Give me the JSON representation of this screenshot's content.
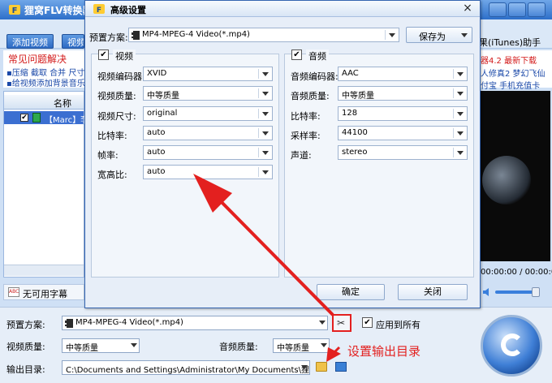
{
  "main": {
    "title": "狸窝FLV转换器",
    "toolbar": {
      "add_video": "添加视频",
      "video2": "视频",
      "itunes": "果(iTunes)助手"
    },
    "faq": {
      "title": "常见问题解决",
      "line1": "▪压缩 截取 合并 尺寸",
      "line2": "▪给视频添加背景音乐"
    },
    "ads": {
      "line1": "器4.2 最新下载",
      "line2": "人修真2 梦幻飞仙",
      "line3": "付宝 手机充值卡"
    },
    "list": {
      "header": "名称",
      "row_text": "【Marc】李"
    },
    "time": "00:00:00 / 00:00:00",
    "subtitle": {
      "label": "无可用字幕",
      "icon_text": "ABC"
    },
    "bottom": {
      "preset_label": "预置方案:",
      "preset_value": "MP4-MPEG-4 Video(*.mp4)",
      "apply_all_label": "应用到所有",
      "video_quality_label": "视频质量:",
      "video_quality_value": "中等质量",
      "audio_quality_label": "音频质量:",
      "audio_quality_value": "中等质量",
      "output_label": "输出目录:",
      "output_value": "C:\\Documents and Settings\\Administrator\\My Documents\\狸窝\\F..."
    },
    "annotation": "设置输出目录"
  },
  "dialog": {
    "title": "高级设置",
    "close_glyph": "×",
    "preset_label": "预置方案:",
    "preset_value": "MP4-MPEG-4 Video(*.mp4)",
    "save_as": "保存为",
    "video": {
      "title": "视频",
      "fields": [
        {
          "label": "视频编码器:",
          "value": "XVID"
        },
        {
          "label": "视频质量:",
          "value": "中等质量"
        },
        {
          "label": "视频尺寸:",
          "value": "original"
        },
        {
          "label": "比特率:",
          "value": "auto"
        },
        {
          "label": "帧率:",
          "value": "auto"
        },
        {
          "label": "宽高比:",
          "value": "auto"
        }
      ]
    },
    "audio": {
      "title": "音频",
      "fields": [
        {
          "label": "音频编码器:",
          "value": "AAC"
        },
        {
          "label": "音频质量:",
          "value": "中等质量"
        },
        {
          "label": "比特率:",
          "value": "128"
        },
        {
          "label": "采样率:",
          "value": "44100"
        },
        {
          "label": "声道:",
          "value": "stereo"
        }
      ]
    },
    "ok": "确定",
    "close": "关闭"
  },
  "colors": {
    "accent": "#e3201f",
    "brand_blue": "#2d6fc9",
    "link_blue": "#1a48a8",
    "alert_red": "#d31818"
  },
  "icons": [
    "app-logo-icon",
    "checkbox-icon",
    "film-icon",
    "settings-tools-icon",
    "folder-icon",
    "open-folder-icon",
    "convert-icon",
    "volume-icon",
    "close-icon",
    "dropdown-arrow-icon"
  ]
}
